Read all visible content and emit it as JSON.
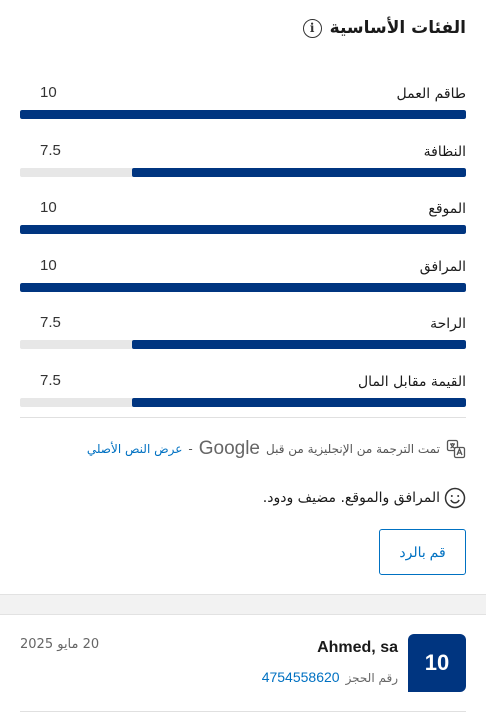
{
  "header": {
    "title": "الفئات الأساسية",
    "info_icon": "i"
  },
  "categories": [
    {
      "label": "طاقم العمل",
      "score": "10",
      "fraction": 1.0
    },
    {
      "label": "النظافة",
      "score": "7.5",
      "fraction": 0.75
    },
    {
      "label": "الموقع",
      "score": "10",
      "fraction": 1.0
    },
    {
      "label": "المرافق",
      "score": "10",
      "fraction": 1.0
    },
    {
      "label": "الراحة",
      "score": "7.5",
      "fraction": 0.75
    },
    {
      "label": "القيمة مقابل المال",
      "score": "7.5",
      "fraction": 0.75
    }
  ],
  "translation": {
    "text": "تمت الترجمة من الإنجليزية من قبل",
    "brand": "Google",
    "separator": "-",
    "show_original": "عرض النص الأصلي"
  },
  "review": {
    "text": "المرافق والموقع. مضيف ودود."
  },
  "reply_button": {
    "label": "قم بالرد"
  },
  "next_review": {
    "score": "10",
    "reviewer": "Ahmed, sa",
    "booking_label": "رقم الحجز",
    "booking_number": "4754558620",
    "date": "20 مايو 2025"
  },
  "colors": {
    "bar_fill": "#003580",
    "bar_track": "#e7e7e7",
    "link": "#0071c2"
  }
}
